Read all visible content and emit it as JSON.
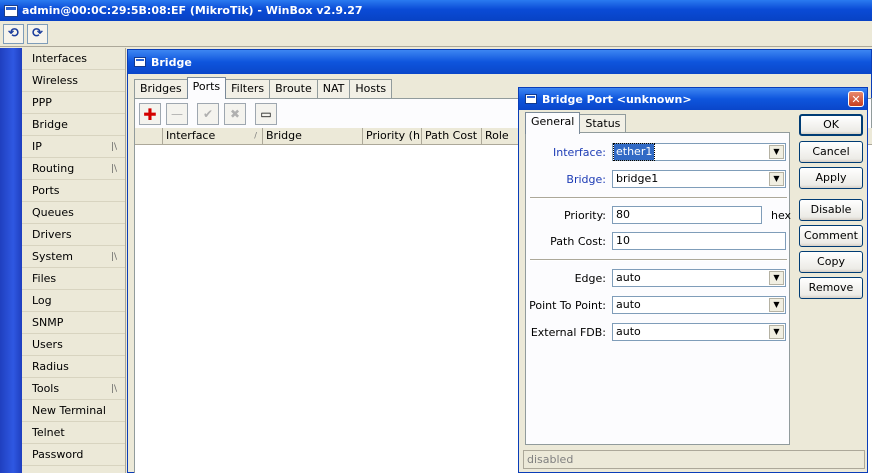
{
  "main_window": {
    "title": "admin@00:0C:29:5B:08:EF (MikroTik) - WinBox v2.9.27",
    "toolbar": {
      "undo_icon": "undo-icon",
      "redo_icon": "redo-icon",
      "undo_glyph": "⟲",
      "redo_glyph": "⟳"
    }
  },
  "sidebar": {
    "items": [
      {
        "label": "Interfaces",
        "submenu": false
      },
      {
        "label": "Wireless",
        "submenu": false
      },
      {
        "label": "PPP",
        "submenu": false
      },
      {
        "label": "Bridge",
        "submenu": false
      },
      {
        "label": "IP",
        "submenu": true
      },
      {
        "label": "Routing",
        "submenu": true
      },
      {
        "label": "Ports",
        "submenu": false
      },
      {
        "label": "Queues",
        "submenu": false
      },
      {
        "label": "Drivers",
        "submenu": false
      },
      {
        "label": "System",
        "submenu": true
      },
      {
        "label": "Files",
        "submenu": false
      },
      {
        "label": "Log",
        "submenu": false
      },
      {
        "label": "SNMP",
        "submenu": false
      },
      {
        "label": "Users",
        "submenu": false
      },
      {
        "label": "Radius",
        "submenu": false
      },
      {
        "label": "Tools",
        "submenu": true
      },
      {
        "label": "New Terminal",
        "submenu": false
      },
      {
        "label": "Telnet",
        "submenu": false
      },
      {
        "label": "Password",
        "submenu": false
      }
    ],
    "submenu_glyph": "|\\"
  },
  "bridge_window": {
    "title": "Bridge",
    "tabs": [
      "Bridges",
      "Ports",
      "Filters",
      "Broute",
      "NAT",
      "Hosts"
    ],
    "active_tab": 1,
    "toolbar": {
      "add_glyph": "✚",
      "remove_glyph": "—",
      "enable_glyph": "✔",
      "disable_glyph": "✖",
      "comment_glyph": "▭"
    },
    "table": {
      "columns": [
        "",
        "Interface",
        "Bridge",
        "Priority (h...",
        "Path Cost",
        "Role"
      ],
      "sort_glyph": "/",
      "rows": []
    }
  },
  "dialog": {
    "title": "Bridge Port <unknown>",
    "close_glyph": "✕",
    "tabs": [
      "General",
      "Status"
    ],
    "active_tab": 0,
    "fields": {
      "interface": {
        "label": "Interface:",
        "value": "ether1"
      },
      "bridge": {
        "label": "Bridge:",
        "value": "bridge1"
      },
      "priority": {
        "label": "Priority:",
        "value": "80",
        "suffix": "hex"
      },
      "path_cost": {
        "label": "Path Cost:",
        "value": "10"
      },
      "edge": {
        "label": "Edge:",
        "value": "auto"
      },
      "point_to_point": {
        "label": "Point To Point:",
        "value": "auto"
      },
      "external_fdb": {
        "label": "External FDB:",
        "value": "auto"
      }
    },
    "dropdown_glyph": "▼",
    "buttons": {
      "ok": "OK",
      "cancel": "Cancel",
      "apply": "Apply",
      "disable": "Disable",
      "comment": "Comment",
      "copy": "Copy",
      "remove": "Remove"
    },
    "status": "disabled"
  },
  "colors": {
    "title_bar": "#0a4bd6",
    "left_strip": "#2f58e2",
    "label_blue": "#1d3cb5",
    "add_red": "#d40000"
  }
}
